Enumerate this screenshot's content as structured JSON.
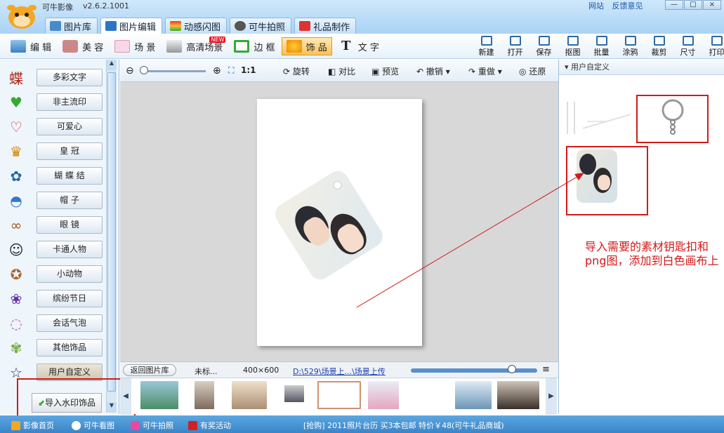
{
  "app": {
    "title": "可牛影像",
    "version": "v2.6.2.1001"
  },
  "top_links": [
    "网站",
    "反馈意见"
  ],
  "window_controls": {
    "minimize": "—",
    "maximize": "□",
    "close": "×"
  },
  "main_tabs": [
    {
      "label": "图片库",
      "icon": "gallery-icon"
    },
    {
      "label": "图片编辑",
      "icon": "edit-photo-icon",
      "active": true
    },
    {
      "label": "动感闪图",
      "icon": "flash-image-icon"
    },
    {
      "label": "可牛拍照",
      "icon": "webcam-icon"
    },
    {
      "label": "礼品制作",
      "icon": "gift-icon"
    }
  ],
  "tool_tabs": [
    {
      "label": "编 辑",
      "icon": "edit-icon"
    },
    {
      "label": "美 容",
      "icon": "beauty-icon"
    },
    {
      "label": "场 景",
      "icon": "scene-icon"
    },
    {
      "label": "高清场景",
      "icon": "hd-scene-icon",
      "badge": "NEW"
    },
    {
      "label": "边 框",
      "icon": "frame-icon"
    },
    {
      "label": "饰 品",
      "icon": "decoration-icon",
      "active": true
    },
    {
      "label": "文 字",
      "icon": "text-icon"
    }
  ],
  "actions": [
    "新建",
    "打开",
    "保存",
    "抠图",
    "批量",
    "涂鸦",
    "裁剪",
    "尺寸",
    "打印"
  ],
  "categories": [
    {
      "label": "多彩文字",
      "glyph": "蝶"
    },
    {
      "label": "非主流印",
      "glyph": "♥"
    },
    {
      "label": "可爱心",
      "glyph": "♡"
    },
    {
      "label": "皇 冠",
      "glyph": "♛"
    },
    {
      "label": "蝴 蝶 结",
      "glyph": "✿"
    },
    {
      "label": "帽 子",
      "glyph": "◓"
    },
    {
      "label": "眼 镜",
      "glyph": "∞"
    },
    {
      "label": "卡通人物",
      "glyph": "☺"
    },
    {
      "label": "小动物",
      "glyph": "✪"
    },
    {
      "label": "缤纷节日",
      "glyph": "❀"
    },
    {
      "label": "会话气泡",
      "glyph": "◌"
    },
    {
      "label": "其他饰品",
      "glyph": "✾"
    },
    {
      "label": "用户自定义",
      "glyph": "☆",
      "active": true
    }
  ],
  "import_button": "导入水印饰品",
  "canvas_tools": {
    "zoom_ratio": "1:1",
    "rotate": "旋转",
    "compare": "对比",
    "preview": "预览",
    "undo": "撤销",
    "redo": "重做",
    "restore": "还原"
  },
  "canvas_bottom": {
    "back": "返回图片库",
    "filename": "未标...",
    "size": "400×600",
    "path": "D:\\529\\场景上...\\场景上传"
  },
  "right_panel": {
    "header": "用户自定义"
  },
  "annotation": "导入需要的素材钥匙扣和png图，添加到白色画布上",
  "status": [
    {
      "label": "影像首页",
      "icon": "home-icon"
    },
    {
      "label": "可牛看图",
      "icon": "viewer-icon"
    },
    {
      "label": "可牛拍照",
      "icon": "camera-icon"
    },
    {
      "label": "有奖活动",
      "icon": "prize-icon"
    }
  ],
  "promo": "[抢购] 2011照片台历 买3本包邮 特价￥48(可牛礼品商城)",
  "colors": {
    "accent": "#3a85c9",
    "highlight": "#f6c25c",
    "annotation": "#d21a1a"
  }
}
